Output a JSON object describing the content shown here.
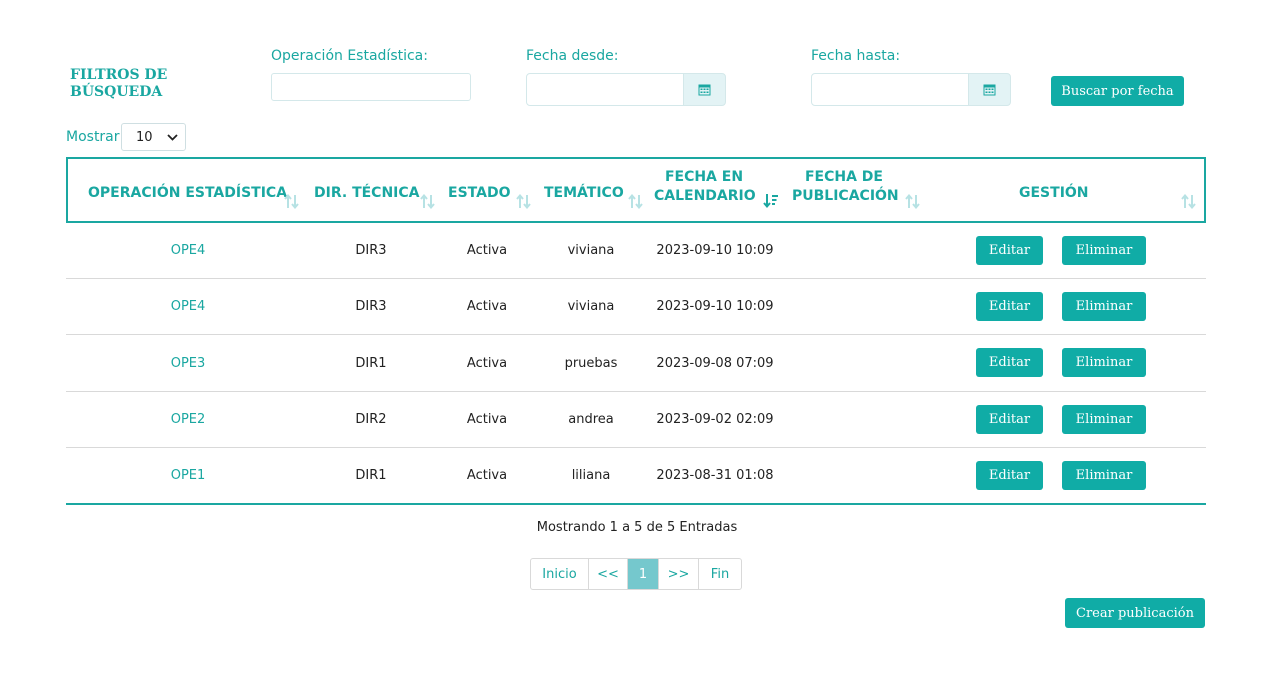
{
  "filters": {
    "title": "FILTROS DE BÚSQUEDA",
    "operacion_label": "Operación Estadística:",
    "operacion_value": "",
    "fecha_desde_label": "Fecha desde:",
    "fecha_desde_value": "",
    "fecha_hasta_label": "Fecha hasta:",
    "fecha_hasta_value": "",
    "search_button": "Buscar por fecha"
  },
  "page_size": {
    "label": "Mostrar",
    "value": "10"
  },
  "table": {
    "headers": {
      "operacion": "OPERACIÓN ESTADÍSTICA",
      "dir": "DIR. TÉCNICA",
      "estado": "ESTADO",
      "tematico": "TEMÁTICO",
      "fecha_cal_1": "FECHA EN",
      "fecha_cal_2": "CALENDARIO",
      "fecha_pub_1": "FECHA DE",
      "fecha_pub_2": "PUBLICACIÓN",
      "gestion": "GESTIÓN"
    },
    "rows": [
      {
        "operacion": "OPE4",
        "dir": "DIR3",
        "estado": "Activa",
        "tematico": "viviana",
        "fecha_cal": "2023-09-10 10:09",
        "fecha_pub": "",
        "edit": "Editar",
        "delete": "Eliminar"
      },
      {
        "operacion": "OPE4",
        "dir": "DIR3",
        "estado": "Activa",
        "tematico": "viviana",
        "fecha_cal": "2023-09-10 10:09",
        "fecha_pub": "",
        "edit": "Editar",
        "delete": "Eliminar"
      },
      {
        "operacion": "OPE3",
        "dir": "DIR1",
        "estado": "Activa",
        "tematico": "pruebas",
        "fecha_cal": "2023-09-08 07:09",
        "fecha_pub": "",
        "edit": "Editar",
        "delete": "Eliminar"
      },
      {
        "operacion": "OPE2",
        "dir": "DIR2",
        "estado": "Activa",
        "tematico": "andrea",
        "fecha_cal": "2023-09-02 02:09",
        "fecha_pub": "",
        "edit": "Editar",
        "delete": "Eliminar"
      },
      {
        "operacion": "OPE1",
        "dir": "DIR1",
        "estado": "Activa",
        "tematico": "liliana",
        "fecha_cal": "2023-08-31 01:08",
        "fecha_pub": "",
        "edit": "Editar",
        "delete": "Eliminar"
      }
    ]
  },
  "summary": "Mostrando 1 a 5 de 5 Entradas",
  "pagination": {
    "first": "Inicio",
    "prev": "<<",
    "current": "1",
    "next": ">>",
    "last": "Fin"
  },
  "create_button": "Crear publicación",
  "colors": {
    "accent": "#1aa7a1",
    "button": "#10aca6",
    "active_page": "#75c8cd",
    "calendar_bg": "#e3f3f5"
  },
  "icons": {
    "calendar": "calendar-icon",
    "sort": "sort-icon",
    "sort_active": "sort-desc-icon",
    "select": "chevron-down-icon"
  }
}
